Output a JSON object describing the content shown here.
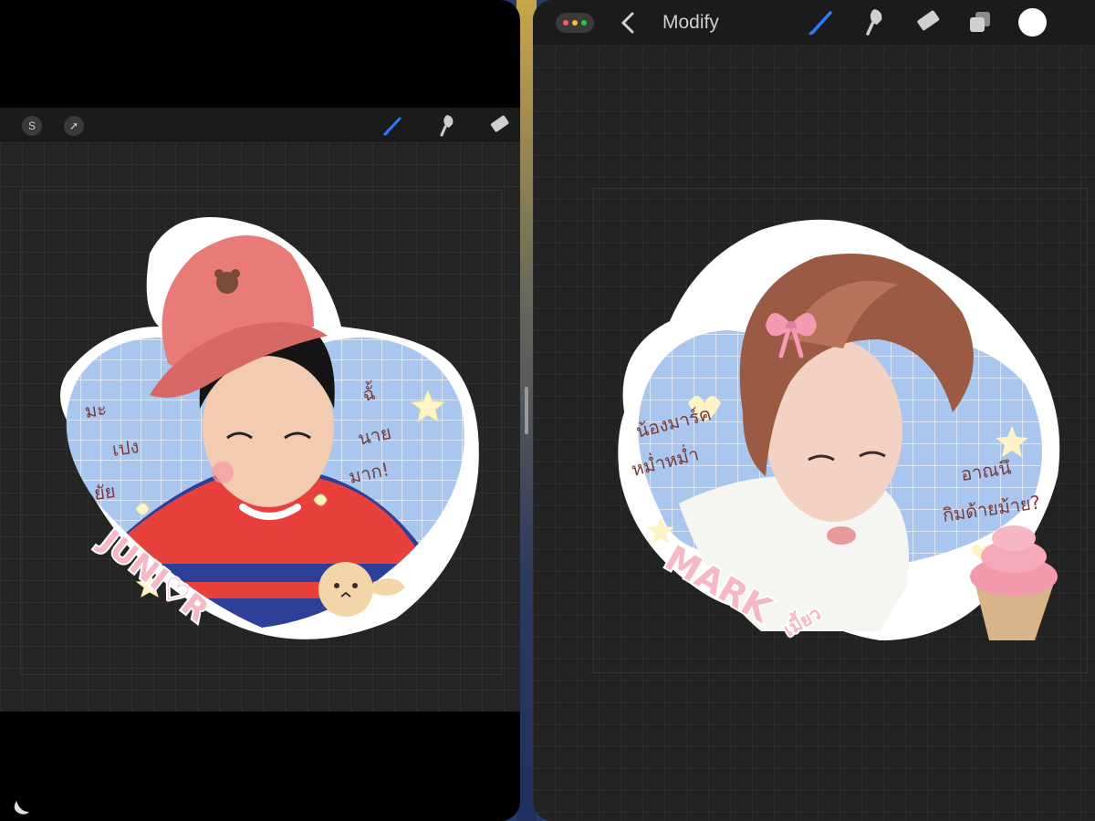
{
  "split_view": {
    "left": {
      "toolbar": {
        "smudge_icon": "S-icon",
        "transform_icon": "arrow-icon",
        "tools": [
          "brush-icon",
          "smudge-icon",
          "eraser-icon"
        ]
      },
      "sticker": {
        "name": "JUNI♡R",
        "thai_left": [
          "มะ",
          "เปง",
          "ยัย"
        ],
        "thai_right": [
          "ฉั้",
          "นาย",
          "มาก!"
        ]
      }
    },
    "right": {
      "topbar": {
        "title": "Modify",
        "window_dots_colors": [
          "#ff5f57",
          "#febc2e",
          "#28c840"
        ],
        "tools": [
          "brush-icon",
          "smudge-icon",
          "eraser-icon",
          "layers-icon",
          "color-swatch"
        ]
      },
      "sticker": {
        "name": "MARK",
        "name_suffix": "เมี้ยว",
        "thai_left": [
          "น้องมาร์ค",
          "หม่ำหม่ำ"
        ],
        "thai_right": [
          "อาณนึ",
          "กิมด้ายม้าย?"
        ]
      }
    }
  },
  "colors": {
    "accent_blue": "#2a7cff",
    "sticker_blue": "#a9c6ef",
    "label_pink": "#f6b8c6",
    "hat_red": "#e87a78"
  }
}
